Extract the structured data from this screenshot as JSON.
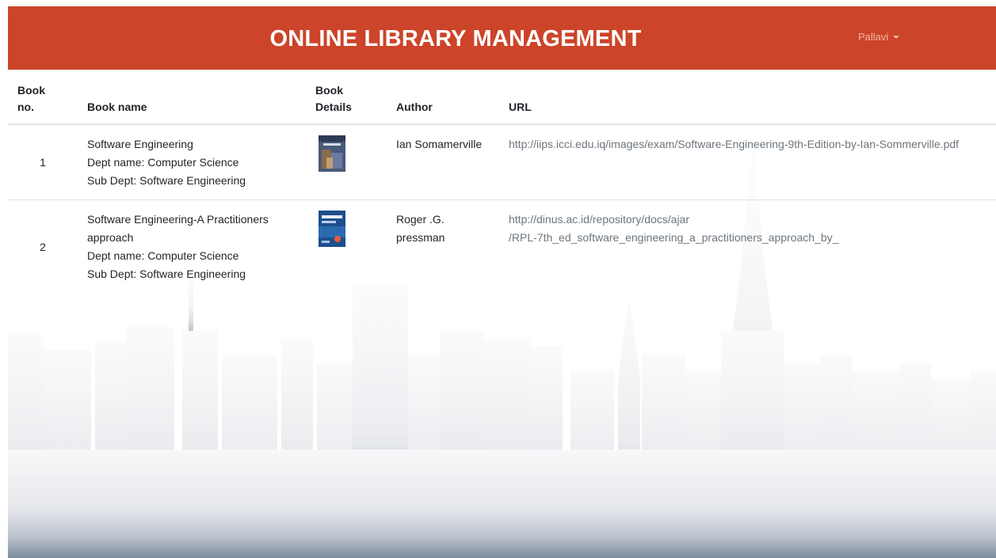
{
  "navbar": {
    "title": "ONLINE LIBRARY MANAGEMENT",
    "user_name": "Pallavi",
    "bg_color": "#cc4429"
  },
  "table": {
    "headers": {
      "book_no": [
        "Book",
        "no."
      ],
      "book_name": "Book name",
      "book_details": [
        "Book",
        "Details"
      ],
      "author": "Author",
      "url": "URL"
    },
    "rows": [
      {
        "no": "1",
        "name": "Software Engineering",
        "dept": "Dept name: Computer Science",
        "sub_dept": "Sub Dept: Software Engineering",
        "cover_icon": "book-cover-image",
        "author": [
          "Ian Somamerville"
        ],
        "url": [
          "http://iips.icci.edu.iq/images/exam/Software-Engineering-9th-Edition-by-Ian-Sommerville.pdf"
        ]
      },
      {
        "no": "2",
        "name": "Software Engineering-A Practitioners approach",
        "dept": "Dept name: Computer Science",
        "sub_dept": "Sub Dept: Software Engineering",
        "cover_icon": "book-cover-image",
        "author": [
          "Roger .G.",
          "pressman"
        ],
        "url": [
          "http://dinus.ac.id/repository/docs/ajar",
          "/RPL-7th_ed_software_engineering_a_practitioners_approach_by_"
        ]
      }
    ]
  }
}
